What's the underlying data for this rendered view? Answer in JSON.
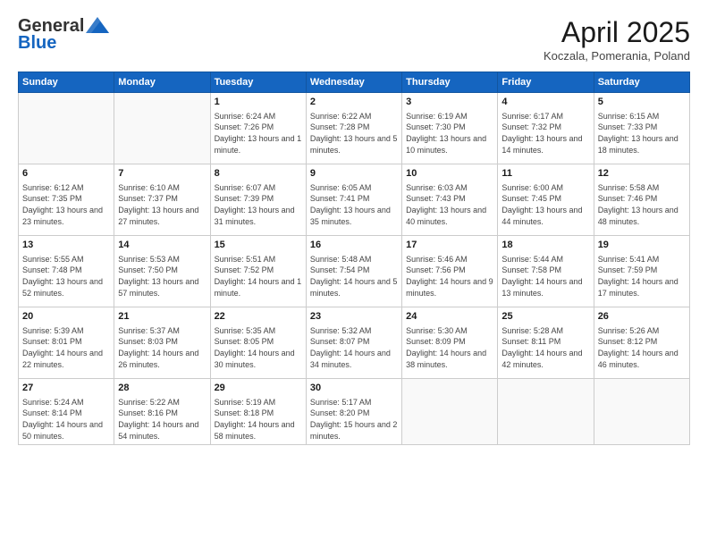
{
  "header": {
    "logo_general": "General",
    "logo_blue": "Blue",
    "month_title": "April 2025",
    "location": "Koczala, Pomerania, Poland"
  },
  "weekdays": [
    "Sunday",
    "Monday",
    "Tuesday",
    "Wednesday",
    "Thursday",
    "Friday",
    "Saturday"
  ],
  "weeks": [
    [
      {
        "day": "",
        "info": ""
      },
      {
        "day": "",
        "info": ""
      },
      {
        "day": "1",
        "info": "Sunrise: 6:24 AM\nSunset: 7:26 PM\nDaylight: 13 hours and 1 minute."
      },
      {
        "day": "2",
        "info": "Sunrise: 6:22 AM\nSunset: 7:28 PM\nDaylight: 13 hours and 5 minutes."
      },
      {
        "day": "3",
        "info": "Sunrise: 6:19 AM\nSunset: 7:30 PM\nDaylight: 13 hours and 10 minutes."
      },
      {
        "day": "4",
        "info": "Sunrise: 6:17 AM\nSunset: 7:32 PM\nDaylight: 13 hours and 14 minutes."
      },
      {
        "day": "5",
        "info": "Sunrise: 6:15 AM\nSunset: 7:33 PM\nDaylight: 13 hours and 18 minutes."
      }
    ],
    [
      {
        "day": "6",
        "info": "Sunrise: 6:12 AM\nSunset: 7:35 PM\nDaylight: 13 hours and 23 minutes."
      },
      {
        "day": "7",
        "info": "Sunrise: 6:10 AM\nSunset: 7:37 PM\nDaylight: 13 hours and 27 minutes."
      },
      {
        "day": "8",
        "info": "Sunrise: 6:07 AM\nSunset: 7:39 PM\nDaylight: 13 hours and 31 minutes."
      },
      {
        "day": "9",
        "info": "Sunrise: 6:05 AM\nSunset: 7:41 PM\nDaylight: 13 hours and 35 minutes."
      },
      {
        "day": "10",
        "info": "Sunrise: 6:03 AM\nSunset: 7:43 PM\nDaylight: 13 hours and 40 minutes."
      },
      {
        "day": "11",
        "info": "Sunrise: 6:00 AM\nSunset: 7:45 PM\nDaylight: 13 hours and 44 minutes."
      },
      {
        "day": "12",
        "info": "Sunrise: 5:58 AM\nSunset: 7:46 PM\nDaylight: 13 hours and 48 minutes."
      }
    ],
    [
      {
        "day": "13",
        "info": "Sunrise: 5:55 AM\nSunset: 7:48 PM\nDaylight: 13 hours and 52 minutes."
      },
      {
        "day": "14",
        "info": "Sunrise: 5:53 AM\nSunset: 7:50 PM\nDaylight: 13 hours and 57 minutes."
      },
      {
        "day": "15",
        "info": "Sunrise: 5:51 AM\nSunset: 7:52 PM\nDaylight: 14 hours and 1 minute."
      },
      {
        "day": "16",
        "info": "Sunrise: 5:48 AM\nSunset: 7:54 PM\nDaylight: 14 hours and 5 minutes."
      },
      {
        "day": "17",
        "info": "Sunrise: 5:46 AM\nSunset: 7:56 PM\nDaylight: 14 hours and 9 minutes."
      },
      {
        "day": "18",
        "info": "Sunrise: 5:44 AM\nSunset: 7:58 PM\nDaylight: 14 hours and 13 minutes."
      },
      {
        "day": "19",
        "info": "Sunrise: 5:41 AM\nSunset: 7:59 PM\nDaylight: 14 hours and 17 minutes."
      }
    ],
    [
      {
        "day": "20",
        "info": "Sunrise: 5:39 AM\nSunset: 8:01 PM\nDaylight: 14 hours and 22 minutes."
      },
      {
        "day": "21",
        "info": "Sunrise: 5:37 AM\nSunset: 8:03 PM\nDaylight: 14 hours and 26 minutes."
      },
      {
        "day": "22",
        "info": "Sunrise: 5:35 AM\nSunset: 8:05 PM\nDaylight: 14 hours and 30 minutes."
      },
      {
        "day": "23",
        "info": "Sunrise: 5:32 AM\nSunset: 8:07 PM\nDaylight: 14 hours and 34 minutes."
      },
      {
        "day": "24",
        "info": "Sunrise: 5:30 AM\nSunset: 8:09 PM\nDaylight: 14 hours and 38 minutes."
      },
      {
        "day": "25",
        "info": "Sunrise: 5:28 AM\nSunset: 8:11 PM\nDaylight: 14 hours and 42 minutes."
      },
      {
        "day": "26",
        "info": "Sunrise: 5:26 AM\nSunset: 8:12 PM\nDaylight: 14 hours and 46 minutes."
      }
    ],
    [
      {
        "day": "27",
        "info": "Sunrise: 5:24 AM\nSunset: 8:14 PM\nDaylight: 14 hours and 50 minutes."
      },
      {
        "day": "28",
        "info": "Sunrise: 5:22 AM\nSunset: 8:16 PM\nDaylight: 14 hours and 54 minutes."
      },
      {
        "day": "29",
        "info": "Sunrise: 5:19 AM\nSunset: 8:18 PM\nDaylight: 14 hours and 58 minutes."
      },
      {
        "day": "30",
        "info": "Sunrise: 5:17 AM\nSunset: 8:20 PM\nDaylight: 15 hours and 2 minutes."
      },
      {
        "day": "",
        "info": ""
      },
      {
        "day": "",
        "info": ""
      },
      {
        "day": "",
        "info": ""
      }
    ]
  ]
}
